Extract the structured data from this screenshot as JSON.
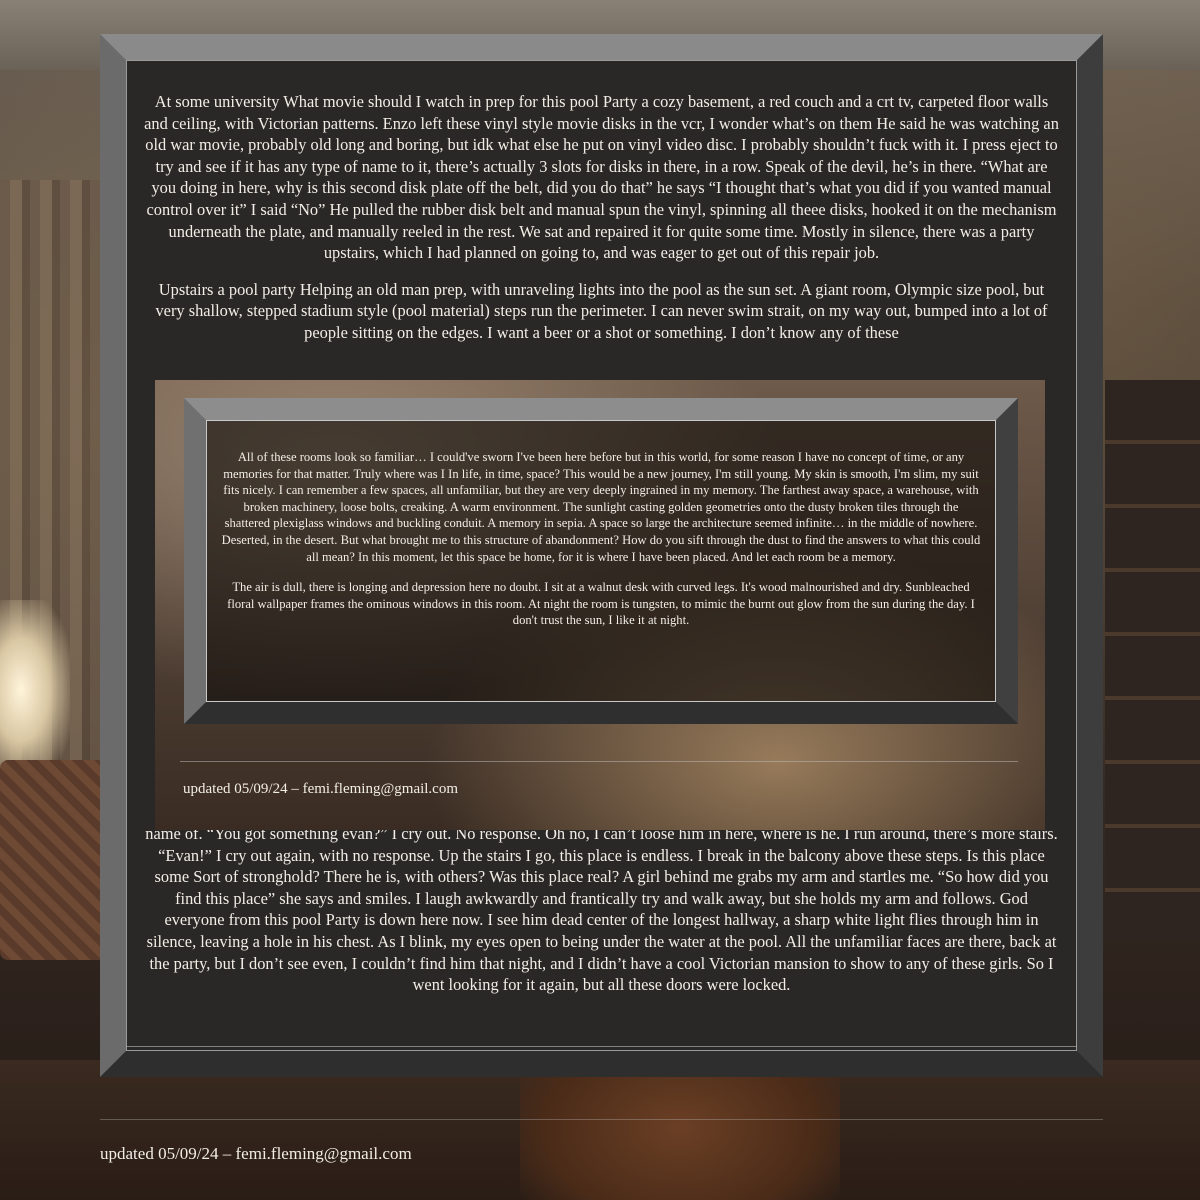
{
  "main": {
    "paragraphs": [
      "At some university What movie should I watch in prep for this pool Party a cozy basement, a red couch and a crt tv, carpeted floor walls and ceiling, with Victorian patterns. Enzo left these vinyl style movie disks in the vcr, I wonder what’s on them He said he was watching an old war movie, probably old long and boring, but idk what else he put on vinyl video disc. I probably shouldn’t fuck with it. I press eject to try and see if it has any type of name to it, there’s actually 3 slots for disks in there, in a row. Speak of the devil, he’s in there. “What are you doing in here, why is this second disk plate off the belt, did you do that” he says “I thought that’s what you did if you wanted manual control over it” I said “No” He pulled the rubber disk belt and manual spun the vinyl, spinning all theee disks, hooked it on the mechanism underneath the plate, and manually reeled in the rest. We sat and repaired it for quite some time. Mostly in silence, there was a party upstairs, which I had planned on going to, and was eager to get out of this repair job.",
      "Upstairs a pool party Helping an old man prep, with unraveling lights into the pool as the sun set. A giant room, Olympic size pool, but very shallow, stepped stadium style (pool material) steps run the perimeter. I can never swim strait, on my way out, bumped into a lot of people sitting on the edges. I want a beer or a shot or something. I don’t know any of these",
      "name of. “You got something evan?” I cry out. No response. Oh no, I can’t loose him in here, where is he. I run around, there’s more stairs. “Evan!” I cry out again, with no response. Up the stairs I go, this place is endless. I break in the balcony above these steps. Is this place some Sort of stronghold? There he is, with others? Was this place real? A girl behind me grabs my arm and startles me. “So how did you find this place” she says and smiles. I laugh awkwardly and frantically try and walk away, but she holds my arm and follows. God everyone from this pool Party is down here now. I see him dead center of the longest hallway, a sharp white light flies through him in silence, leaving a hole in his chest. As I blink, my eyes open to being under the water at the pool. All the unfamiliar faces are there, back at the party, but I don’t see even, I couldn’t find him that night, and I didn’t have a cool Victorian mansion to show to any of these girls. So I went looking for it again, but all these doors were locked."
    ]
  },
  "overlay": {
    "paragraphs": [
      "All of these rooms look so familiar… I could've sworn I've been here before but in this world, for some reason I have no concept of time, or any memories for that matter. Truly where was I In life, in time, space? This would be a new journey, I'm still young. My skin is smooth, I'm slim, my suit fits nicely. I can remember a few spaces, all unfamiliar, but they are very deeply ingrained in my memory. The farthest away space, a warehouse, with broken machinery, loose bolts, creaking. A warm environment. The sunlight casting golden geometries onto the dusty broken tiles through the shattered plexiglass windows and buckling conduit. A memory in sepia. A space so large the architecture seemed infinite… in the middle of nowhere. Deserted, in the desert. But what brought me to this structure of abandonment? How do you sift through the dust to find the answers to what this could all mean? In this moment, let this space be home, for it is where I have been placed. And let each room be a memory.",
      "The air is dull, there is longing and depression here no doubt. I sit at a walnut desk with curved legs. It's wood malnourished and dry. Sunbleached floral wallpaper frames the ominous windows in this room. At night the room is tungsten, to mimic the burnt out glow from the sun during the day. I don't trust the sun, I like it at night."
    ],
    "footer": "updated 05/09/24 – femi.fleming@gmail.com"
  },
  "page": {
    "footer": "updated 05/09/24 – femi.fleming@gmail.com"
  }
}
